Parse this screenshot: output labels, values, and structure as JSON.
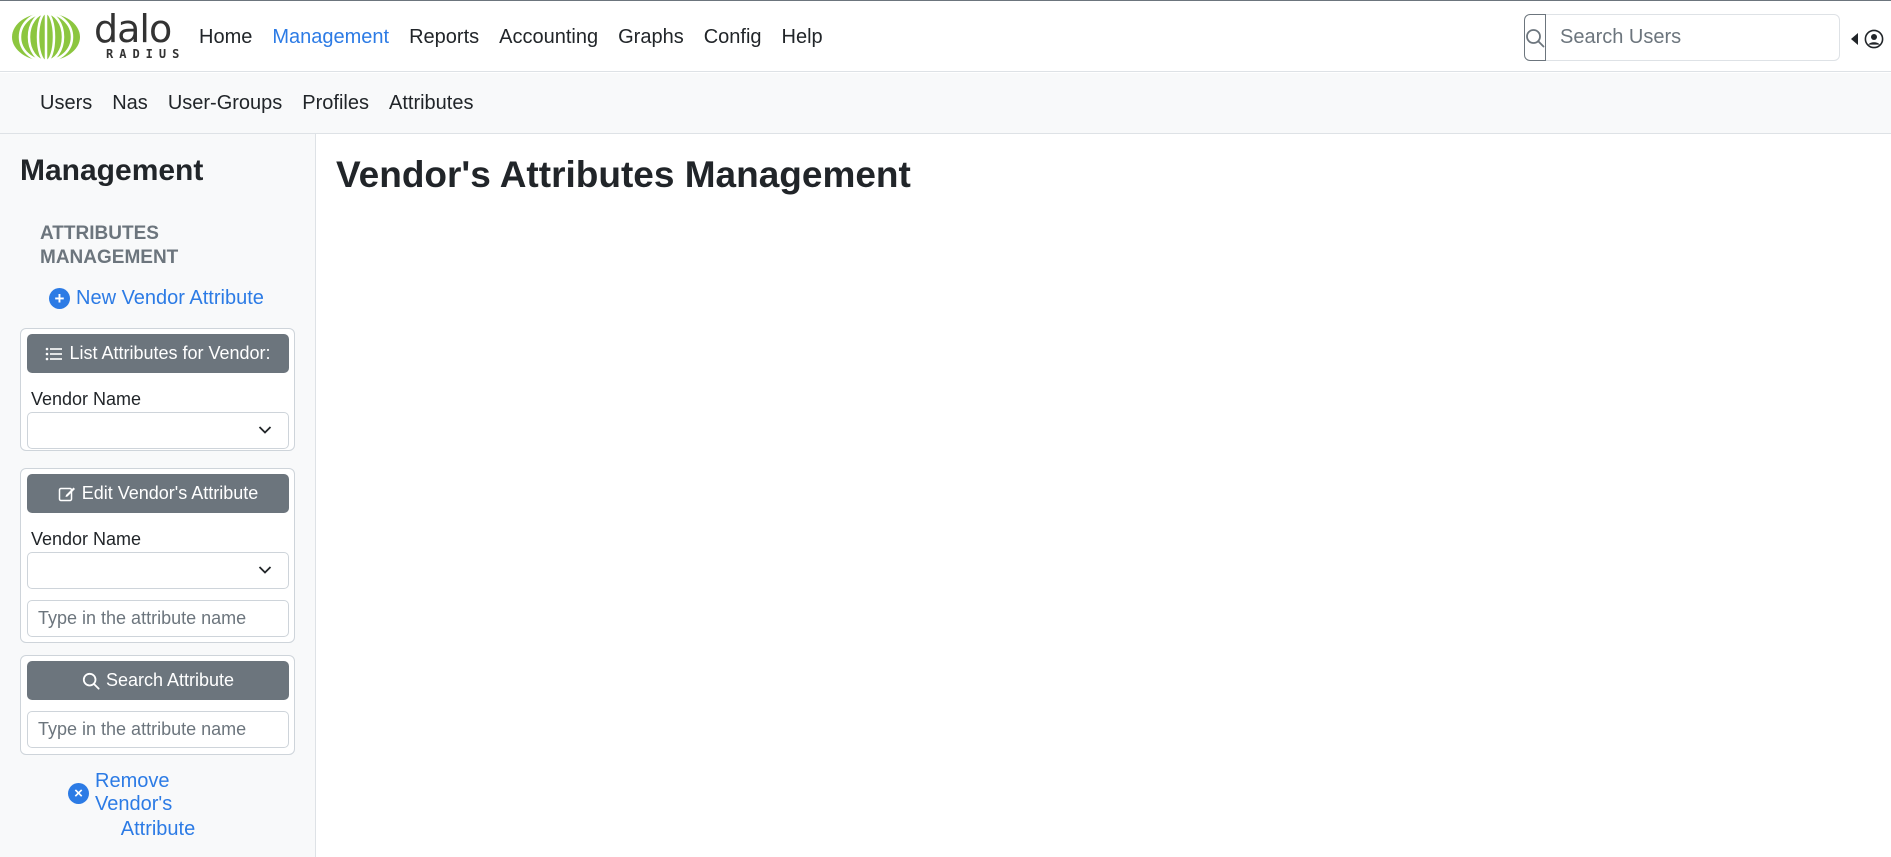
{
  "brand": {
    "logo_text": "dalo",
    "logo_subtext": "RADIUS"
  },
  "main_nav": [
    {
      "label": "Home",
      "active": false
    },
    {
      "label": "Management",
      "active": true
    },
    {
      "label": "Reports",
      "active": false
    },
    {
      "label": "Accounting",
      "active": false
    },
    {
      "label": "Graphs",
      "active": false
    },
    {
      "label": "Config",
      "active": false
    },
    {
      "label": "Help",
      "active": false
    }
  ],
  "search": {
    "placeholder": "Search Users",
    "value": "",
    "icon": "search-icon"
  },
  "user_menu": {
    "icon": "user-circle-icon"
  },
  "sub_nav": [
    {
      "label": "Users"
    },
    {
      "label": "Nas"
    },
    {
      "label": "User-Groups"
    },
    {
      "label": "Profiles"
    },
    {
      "label": "Attributes"
    }
  ],
  "sidebar": {
    "title": "Management",
    "section_heading": "ATTRIBUTES MANAGEMENT",
    "new_vendor_attribute": "New Vendor Attribute",
    "list_card": {
      "button": "List Attributes for Vendor:",
      "vendor_label": "Vendor Name",
      "vendor_value": ""
    },
    "edit_card": {
      "button": "Edit Vendor's Attribute",
      "vendor_label": "Vendor Name",
      "vendor_value": "",
      "attribute_placeholder": "Type in the attribute name"
    },
    "search_card": {
      "button": "Search Attribute",
      "attribute_placeholder": "Type in the attribute name"
    },
    "remove_link": {
      "line1": "Remove Vendor's",
      "line2": "Attribute"
    }
  },
  "main": {
    "title": "Vendor's Attributes Management"
  },
  "colors": {
    "accent": "#2c7be5",
    "logo_green": "#8cc63f",
    "button_gray": "#6c757d",
    "sidebar_bg": "#f8f9fa"
  }
}
